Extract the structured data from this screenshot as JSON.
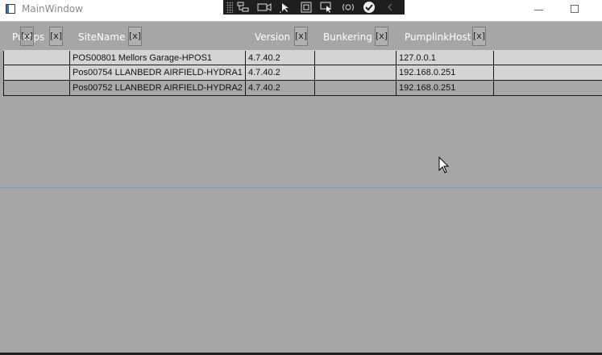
{
  "window": {
    "title": "MainWindow"
  },
  "header": {
    "columns": [
      {
        "label": "Pumps",
        "remove_label": "[x]"
      },
      {
        "label": "SiteName",
        "remove_label": "[x]"
      },
      {
        "label": "Version",
        "remove_label": "[x]"
      },
      {
        "label": "Bunkering",
        "remove_label": "[x]"
      },
      {
        "label": "PumplinkHost",
        "remove_label": "[x]"
      }
    ],
    "pumps_overlay_remove_label": "[x]"
  },
  "rows": [
    {
      "pumps": "",
      "site_name": "POS00801 Mellors Garage-HPOS1",
      "version": "4.7.40.2",
      "bunkering": "",
      "pumplink_host": "127.0.0.1"
    },
    {
      "pumps": "",
      "site_name": "Pos00754 LLANBEDR AIRFIELD-HYDRA1",
      "version": "4.7.40.2",
      "bunkering": "",
      "pumplink_host": "192.168.0.251"
    },
    {
      "pumps": "",
      "site_name": "Pos00752 LLANBEDR AIRFIELD-HYDRA2",
      "version": "4.7.40.2",
      "bunkering": "",
      "pumplink_host": "192.168.0.251"
    }
  ],
  "debug_toolbar": {
    "icons": [
      "live-visual-tree-icon",
      "record-icon",
      "select-element-icon",
      "display-layout-adorners-icon",
      "track-focus-icon",
      "hot-reload-icon",
      "binding-failures-icon",
      "collapse-icon"
    ]
  },
  "colors": {
    "background": "#a6a6a5",
    "row_alt": "#d4d4d4",
    "header_text": "#ffffff"
  }
}
